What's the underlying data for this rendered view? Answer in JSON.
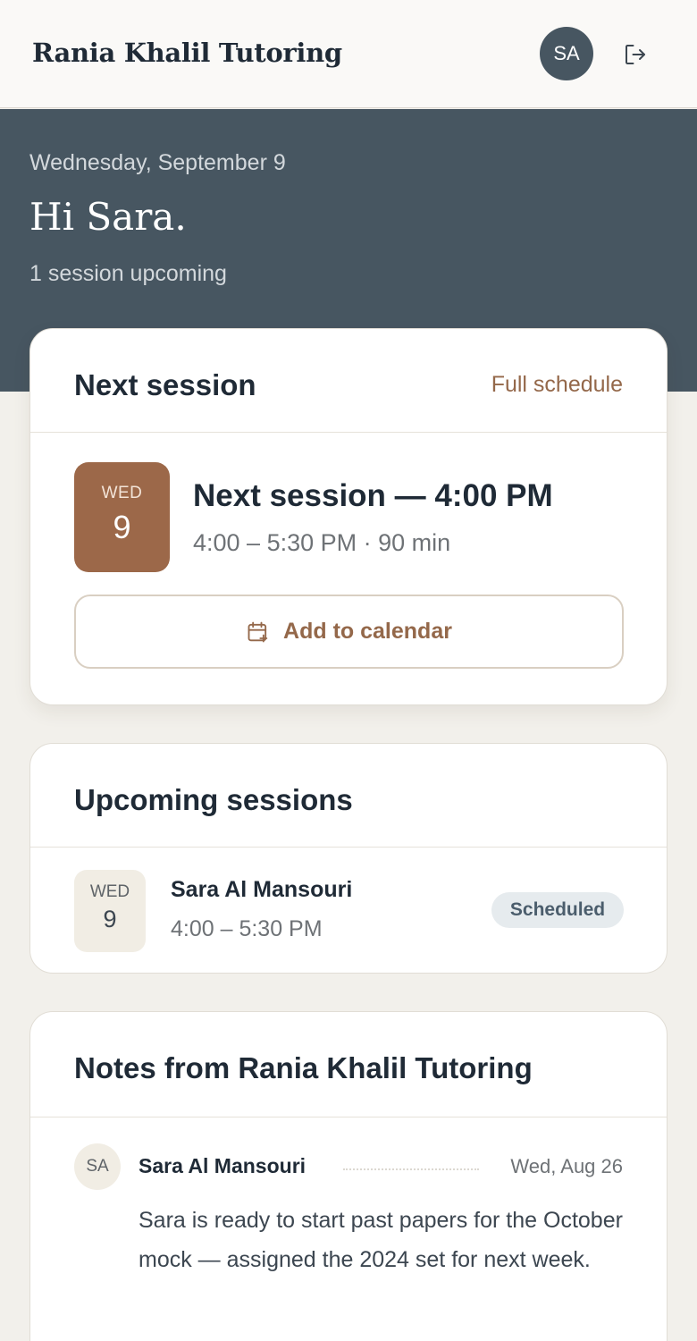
{
  "header": {
    "brand": "Rania Khalil Tutoring",
    "avatar_initials": "SA"
  },
  "hero": {
    "date": "Wednesday, September 9",
    "greeting": "Hi Sara.",
    "subtitle": "1 session upcoming"
  },
  "next_session": {
    "card_title": "Next session",
    "full_schedule_label": "Full schedule",
    "dow": "WED",
    "day": "9",
    "title": "Next session — 4:00 PM",
    "time": "4:00 – 5:30 PM · 90 min",
    "add_calendar_label": "Add to calendar"
  },
  "upcoming": {
    "card_title": "Upcoming sessions",
    "items": [
      {
        "dow": "WED",
        "day": "9",
        "name": "Sara Al Mansouri",
        "time": "4:00 – 5:30 PM",
        "status": "Scheduled"
      }
    ]
  },
  "notes": {
    "card_title": "Notes from Rania Khalil Tutoring",
    "items": [
      {
        "initials": "SA",
        "author": "Sara Al Mansouri",
        "date": "Wed, Aug 26",
        "text": "Sara is ready to start past papers for the October mock — assigned the 2024 set for next week."
      }
    ]
  },
  "colors": {
    "hero_bg": "#475661",
    "accent": "#9c6849",
    "link": "#94684a",
    "badge_bg": "#e6ebee"
  },
  "icons": [
    "logout-icon",
    "calendar-add-icon"
  ]
}
